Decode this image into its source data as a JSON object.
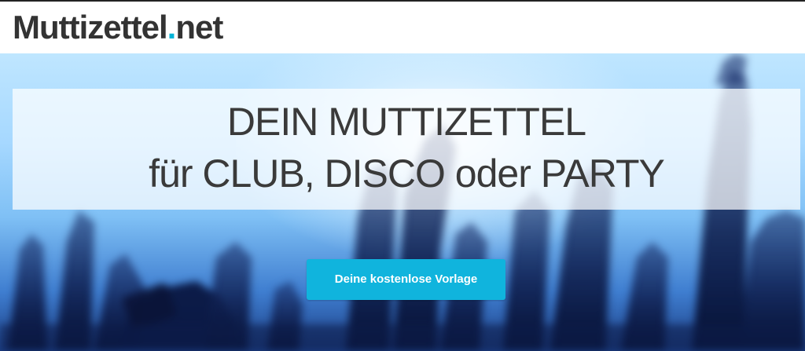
{
  "header": {
    "logo_main": "Muttizettel",
    "logo_dot": ".",
    "logo_tld": "net"
  },
  "hero": {
    "title_line1": "DEIN MUTTIZETTEL",
    "title_line2": "für CLUB, DISCO oder PARTY",
    "cta_label": "Deine kostenlose Vorlage"
  },
  "colors": {
    "accent": "#10b4dd",
    "logo_text": "#333333",
    "logo_dot": "#00b4d8",
    "title_text": "#3a3a3a"
  }
}
